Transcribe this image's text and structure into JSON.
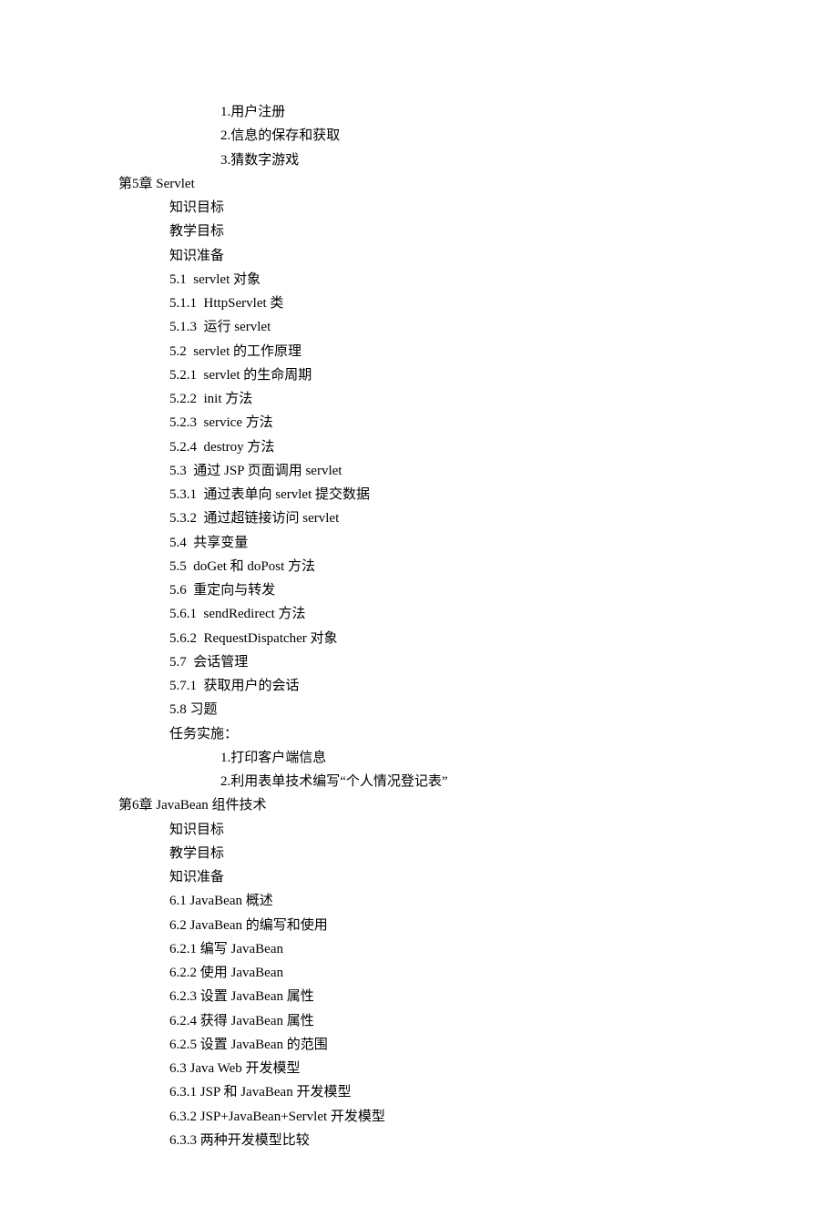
{
  "lines": [
    {
      "indent": 3,
      "text": "1.用户注册"
    },
    {
      "indent": 3,
      "text": "2.信息的保存和获取"
    },
    {
      "indent": 3,
      "text": "3.猜数字游戏"
    },
    {
      "indent": 1,
      "text": "第5章 Servlet"
    },
    {
      "indent": 2,
      "text": "知识目标"
    },
    {
      "indent": 2,
      "text": "教学目标"
    },
    {
      "indent": 2,
      "text": "知识准备"
    },
    {
      "indent": 2,
      "text": "5.1  servlet 对象"
    },
    {
      "indent": 2,
      "text": "5.1.1  HttpServlet 类"
    },
    {
      "indent": 2,
      "text": "5.1.3  运行 servlet"
    },
    {
      "indent": 2,
      "text": "5.2  servlet 的工作原理"
    },
    {
      "indent": 2,
      "text": "5.2.1  servlet 的生命周期"
    },
    {
      "indent": 2,
      "text": "5.2.2  init 方法"
    },
    {
      "indent": 2,
      "text": "5.2.3  service 方法"
    },
    {
      "indent": 2,
      "text": "5.2.4  destroy 方法"
    },
    {
      "indent": 2,
      "text": "5.3  通过 JSP 页面调用 servlet"
    },
    {
      "indent": 2,
      "text": "5.3.1  通过表单向 servlet 提交数据"
    },
    {
      "indent": 2,
      "text": "5.3.2  通过超链接访问 servlet"
    },
    {
      "indent": 2,
      "text": "5.4  共享变量"
    },
    {
      "indent": 2,
      "text": "5.5  doGet 和 doPost 方法"
    },
    {
      "indent": 2,
      "text": "5.6  重定向与转发"
    },
    {
      "indent": 2,
      "text": "5.6.1  sendRedirect 方法"
    },
    {
      "indent": 2,
      "text": "5.6.2  RequestDispatcher 对象"
    },
    {
      "indent": 2,
      "text": "5.7  会话管理"
    },
    {
      "indent": 2,
      "text": "5.7.1  获取用户的会话"
    },
    {
      "indent": 2,
      "text": "5.8 习题"
    },
    {
      "indent": 2,
      "text": "任务实施："
    },
    {
      "indent": 3,
      "text": "1.打印客户端信息"
    },
    {
      "indent": 3,
      "text": "2.利用表单技术编写“个人情况登记表”"
    },
    {
      "indent": 1,
      "text": "第6章 JavaBean 组件技术"
    },
    {
      "indent": 2,
      "text": "知识目标"
    },
    {
      "indent": 2,
      "text": "教学目标"
    },
    {
      "indent": 2,
      "text": "知识准备"
    },
    {
      "indent": 2,
      "text": "6.1 JavaBean 概述"
    },
    {
      "indent": 2,
      "text": "6.2 JavaBean 的编写和使用"
    },
    {
      "indent": 2,
      "text": "6.2.1 编写 JavaBean"
    },
    {
      "indent": 2,
      "text": "6.2.2 使用 JavaBean"
    },
    {
      "indent": 2,
      "text": "6.2.3 设置 JavaBean 属性"
    },
    {
      "indent": 2,
      "text": "6.2.4 获得 JavaBean 属性"
    },
    {
      "indent": 2,
      "text": "6.2.5 设置 JavaBean 的范围"
    },
    {
      "indent": 2,
      "text": "6.3 Java Web 开发模型"
    },
    {
      "indent": 2,
      "text": "6.3.1 JSP 和 JavaBean 开发模型"
    },
    {
      "indent": 2,
      "text": "6.3.2 JSP+JavaBean+Servlet 开发模型"
    },
    {
      "indent": 2,
      "text": "6.3.3 两种开发模型比较"
    }
  ]
}
